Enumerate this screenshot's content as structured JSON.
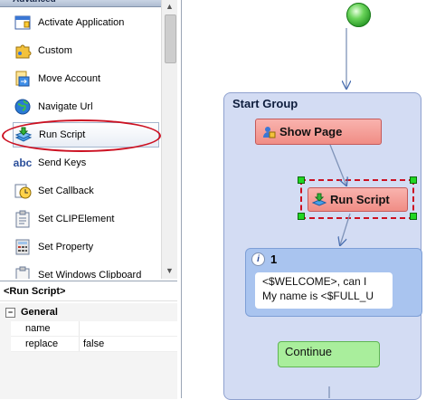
{
  "toolbox": {
    "header": "Advanced",
    "items": [
      {
        "label": "Activate Application",
        "icon": "window-app-icon"
      },
      {
        "label": "Custom",
        "icon": "puzzle-icon"
      },
      {
        "label": "Move Account",
        "icon": "move-account-icon"
      },
      {
        "label": "Navigate Url",
        "icon": "globe-icon"
      },
      {
        "label": "Run Script",
        "icon": "run-script-icon"
      },
      {
        "label": "Send Keys",
        "icon": "abc-icon"
      },
      {
        "label": "Set Callback",
        "icon": "clock-callback-icon"
      },
      {
        "label": "Set CLIPElement",
        "icon": "clipboard-icon"
      },
      {
        "label": "Set Property",
        "icon": "calculator-icon"
      },
      {
        "label": "Set Windows Clipboard",
        "icon": "clipboard-icon"
      }
    ]
  },
  "properties": {
    "title": "<Run Script>",
    "category": "General",
    "toggle": "−",
    "rows": [
      {
        "name": "name",
        "value": ""
      },
      {
        "name": "replace",
        "value": "false"
      }
    ]
  },
  "canvas": {
    "group_title": "Start Group",
    "show_page_label": "Show Page",
    "run_script_label": "Run Script",
    "message_number": "1",
    "message_lines": [
      "<$WELCOME>, can I",
      "My name is <$FULL_U"
    ],
    "continue_label": "Continue"
  },
  "colors": {
    "highlight_red": "#cc1122",
    "group_fill": "#d3dcf3",
    "node_red": "#f08d85",
    "message_blue": "#a9c4ef",
    "continue_green": "#a9ee9c",
    "handle_green": "#22d722"
  }
}
